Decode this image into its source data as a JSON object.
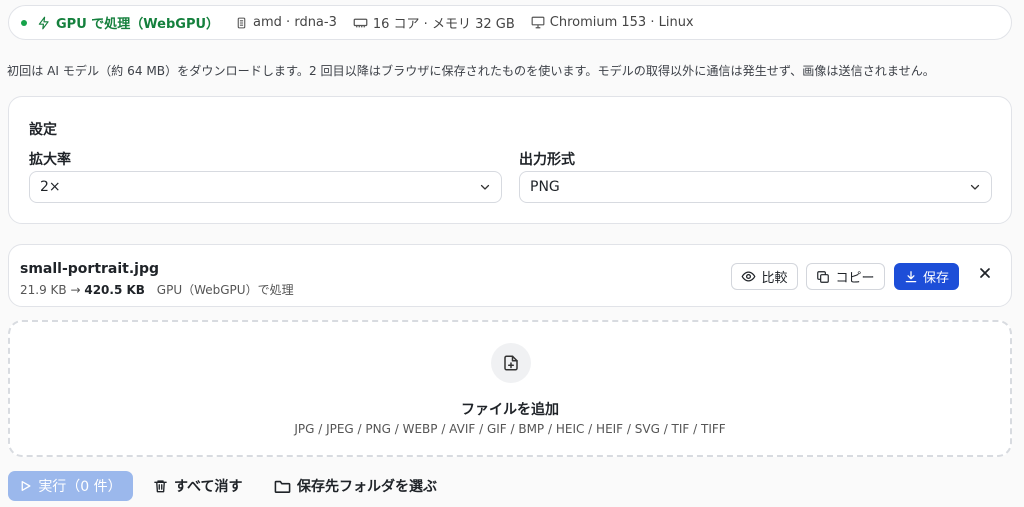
{
  "status": {
    "mode": "GPU で処理（WebGPU）",
    "gpu": "amd · rdna-3",
    "hardware": "16 コア · メモリ 32 GB",
    "browser": "Chromium 153 · Linux"
  },
  "notice": "初回は AI モデル（約 64 MB）をダウンロードします。2 回目以降はブラウザに保存されたものを使います。モデルの取得以外に通信は発生せず、画像は送信されません。",
  "settings": {
    "title": "設定",
    "scale_label": "拡大率",
    "scale_value": "2×",
    "format_label": "出力形式",
    "format_value": "PNG"
  },
  "file": {
    "name": "small-portrait.jpg",
    "input_size": "21.9 KB",
    "arrow": "→",
    "output_size": "420.5 KB",
    "mode": "GPU（WebGPU）で処理",
    "compare_label": "比較",
    "copy_label": "コピー",
    "save_label": "保存"
  },
  "dropzone": {
    "title": "ファイルを追加",
    "types": "JPG / JPEG / PNG / WEBP / AVIF / GIF / BMP / HEIC / HEIF / SVG / TIF / TIFF"
  },
  "actions": {
    "run_label": "実行（0 件）",
    "clear_label": "すべて消す",
    "folder_label": "保存先フォルダを選ぶ"
  },
  "colors": {
    "accent": "#1d4ed8",
    "status_ok": "#16a34a",
    "run_disabled": "#9bb8ec"
  }
}
